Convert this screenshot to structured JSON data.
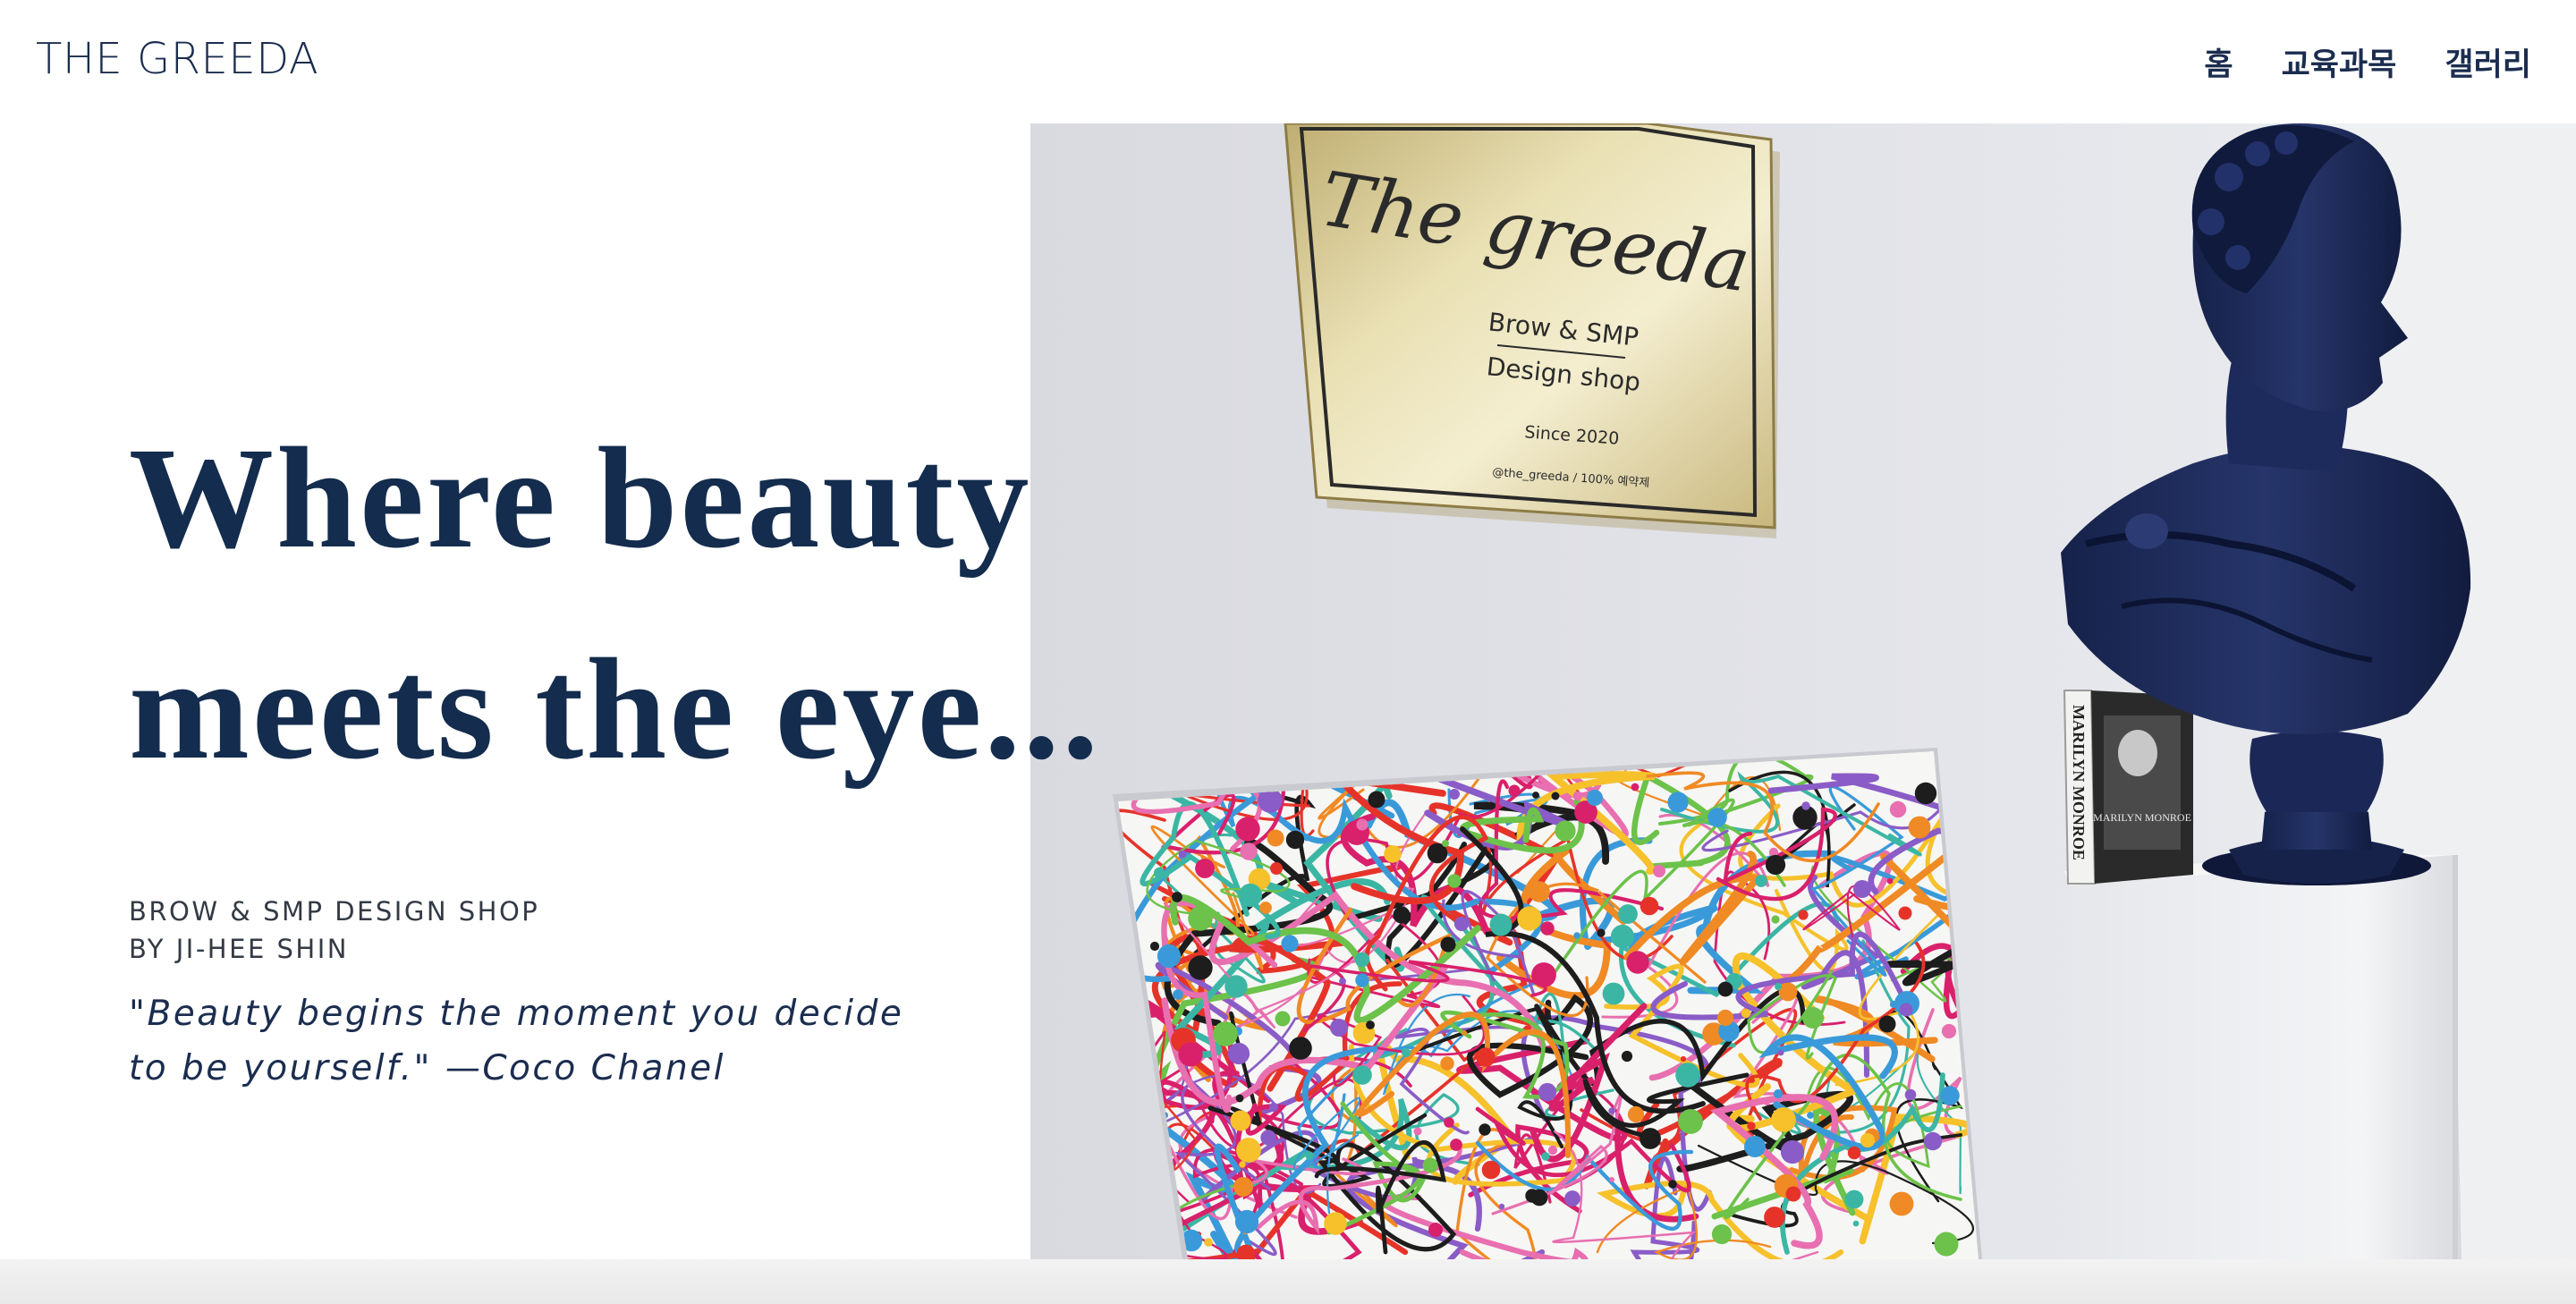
{
  "header": {
    "brand": "THE GREEDA",
    "nav": [
      {
        "label": "홈"
      },
      {
        "label": "교육과목"
      },
      {
        "label": "갤러리"
      }
    ]
  },
  "hero": {
    "headline_line1": "Where beauty",
    "headline_line2": "meets the eye...",
    "subtitle_line1": "BROW & SMP DESIGN SHOP",
    "subtitle_line2": "BY JI-HEE SHIN",
    "quote_line1": "\"Beauty begins the moment you decide",
    "quote_line2": "to be yourself.\" —Coco Chanel"
  },
  "photo": {
    "plaque_script": "The greeda",
    "plaque_line1": "Brow & SMP",
    "plaque_line2": "Design shop",
    "plaque_since": "Since 2020",
    "plaque_handle": "@the_greeda / 100% 예약제",
    "book_spine": "MARILYN MONROE",
    "book_cover": "MARILYN MONROE"
  },
  "colors": {
    "navy": "#142c4d",
    "wall": "#dfe0e6",
    "plaque_gold": "#cdbd86",
    "bust": "#1c2a52"
  }
}
